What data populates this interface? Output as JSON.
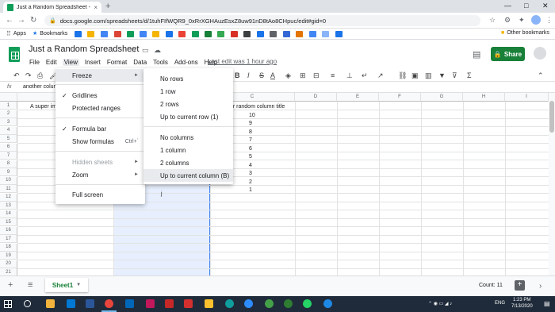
{
  "browser": {
    "tab_title": "Just a Random Spreadsheet - Go",
    "tab_close": "×",
    "new_tab": "+",
    "window_controls": [
      "—",
      "□",
      "✕"
    ],
    "url": "docs.google.com/spreadsheets/d/1tuhFIfWQR9_0xRrXGHAuzEsxZ8uw91nD8tAo8CHpuc/edit#gid=0",
    "bookmarks": {
      "apps_label": "Apps",
      "bookmarks_label": "Bookmarks",
      "other_label": "Other bookmarks"
    }
  },
  "sheets": {
    "doc_title": "Just a Random Spreadsheet",
    "menu": [
      "File",
      "Edit",
      "View",
      "Insert",
      "Format",
      "Data",
      "Tools",
      "Add-ons",
      "Help"
    ],
    "last_edit": "Last edit was 1 hour ago",
    "share_label": "Share",
    "formula_bar_text": "another colum",
    "columns": [
      "A",
      "B",
      "C",
      "D",
      "E",
      "F",
      "G",
      "H",
      "I"
    ],
    "rows": [
      "1",
      "2",
      "3",
      "4",
      "5",
      "6",
      "7",
      "8",
      "9",
      "10",
      "11",
      "12",
      "13",
      "14",
      "15",
      "16",
      "17",
      "18",
      "19",
      "20",
      "21"
    ],
    "cells": {
      "a1": "A super im",
      "c1": "er random column title",
      "c_values": [
        "10",
        "9",
        "8",
        "7",
        "6",
        "5",
        "4",
        "3",
        "2",
        "1"
      ],
      "b11": "j"
    },
    "sheet_tab": "Sheet1",
    "count": "Count: 11"
  },
  "view_menu": {
    "items": [
      {
        "label": "Freeze",
        "checked": false,
        "submenu": true
      },
      {
        "label": "Gridlines",
        "checked": true
      },
      {
        "label": "Protected ranges",
        "checked": false
      },
      {
        "label": "Formula bar",
        "checked": true
      },
      {
        "label": "Show formulas",
        "checked": false,
        "shortcut": "Ctrl+`"
      },
      {
        "label": "Hidden sheets",
        "disabled": true,
        "submenu": true
      },
      {
        "label": "Zoom",
        "submenu": true
      },
      {
        "label": "Full screen"
      }
    ],
    "check_glyph": "✓",
    "arrow_glyph": "►"
  },
  "freeze_submenu": {
    "items": [
      "No rows",
      "1 row",
      "2 rows",
      "Up to current row (1)",
      "No columns",
      "1 column",
      "2 columns",
      "Up to current column (B)"
    ]
  },
  "taskbar": {
    "time": "1:23 PM",
    "date": "7/13/2020",
    "lang": "ENG"
  }
}
